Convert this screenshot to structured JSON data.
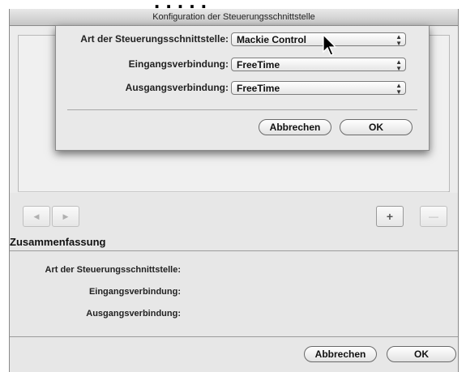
{
  "window": {
    "title": "Konfiguration der Steuerungsschnittstelle"
  },
  "nav": {
    "prev_icon": "◀",
    "next_icon": "▶",
    "add_label": "+",
    "remove_label": "—"
  },
  "summary": {
    "title": "Zusammenfassung",
    "type_label": "Art der Steuerungsschnittstelle:",
    "input_label": "Eingangsverbindung:",
    "output_label": "Ausgangsverbindung:"
  },
  "footer": {
    "cancel_label": "Abbrechen",
    "ok_label": "OK"
  },
  "sheet": {
    "type_label": "Art der Steuerungsschnittstelle:",
    "type_value": "Mackie Control",
    "input_label": "Eingangsverbindung:",
    "input_value": "FreeTime",
    "output_label": "Ausgangsverbindung:",
    "output_value": "FreeTime",
    "cancel_label": "Abbrechen",
    "ok_label": "OK"
  },
  "colors": {
    "window_bg": "#e7e7e7",
    "sheet_bg": "#e9e9e9",
    "border": "#8a8a8a"
  }
}
